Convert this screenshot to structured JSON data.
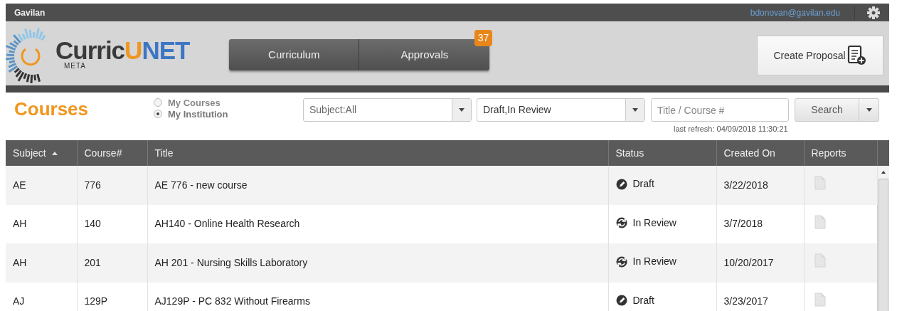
{
  "top_bar": {
    "institution": "Gavilan",
    "user_email": "bdonovan@gavilan.edu"
  },
  "header": {
    "logo": {
      "parts": [
        "Curric",
        "U",
        "NET"
      ],
      "subtitle": "META"
    },
    "tabs": [
      {
        "label": "Curriculum",
        "selected": false
      },
      {
        "label": "Approvals",
        "selected": false,
        "badge": "37"
      }
    ],
    "create_button": "Create Proposal"
  },
  "toolbar": {
    "title": "Courses",
    "scope": [
      {
        "label": "My Courses",
        "selected": false
      },
      {
        "label": "My Institution",
        "selected": true
      }
    ],
    "subject_filter": "Subject:All",
    "status_filter": "Draft,In Review",
    "search": {
      "placeholder": "Title / Course #"
    },
    "search_button": "Search",
    "last_refresh": "last refresh: 04/09/2018 11:30:21"
  },
  "table": {
    "columns": [
      {
        "label": "Subject",
        "sorted": true
      },
      {
        "label": "Course#",
        "sorted": false
      },
      {
        "label": "Title",
        "sorted": false
      },
      {
        "label": "Status",
        "sorted": false
      },
      {
        "label": "Created On",
        "sorted": false
      },
      {
        "label": "Reports",
        "sorted": false
      }
    ],
    "rows": [
      {
        "subject": "AE",
        "course": "776",
        "title": "AE 776 - new course",
        "status": {
          "kind": "draft",
          "label": "Draft"
        },
        "created": "3/22/2018"
      },
      {
        "subject": "AH",
        "course": "140",
        "title": "AH140 - Online Health Research",
        "status": {
          "kind": "review",
          "label": "In Review"
        },
        "created": "3/7/2018"
      },
      {
        "subject": "AH",
        "course": "201",
        "title": "AH 201 - Nursing Skills Laboratory",
        "status": {
          "kind": "review",
          "label": "In Review"
        },
        "created": "10/20/2017"
      },
      {
        "subject": "AJ",
        "course": "129P",
        "title": "AJ129P - PC 832 Without Firearms",
        "status": {
          "kind": "draft",
          "label": "Draft"
        },
        "created": "3/23/2017"
      }
    ]
  }
}
